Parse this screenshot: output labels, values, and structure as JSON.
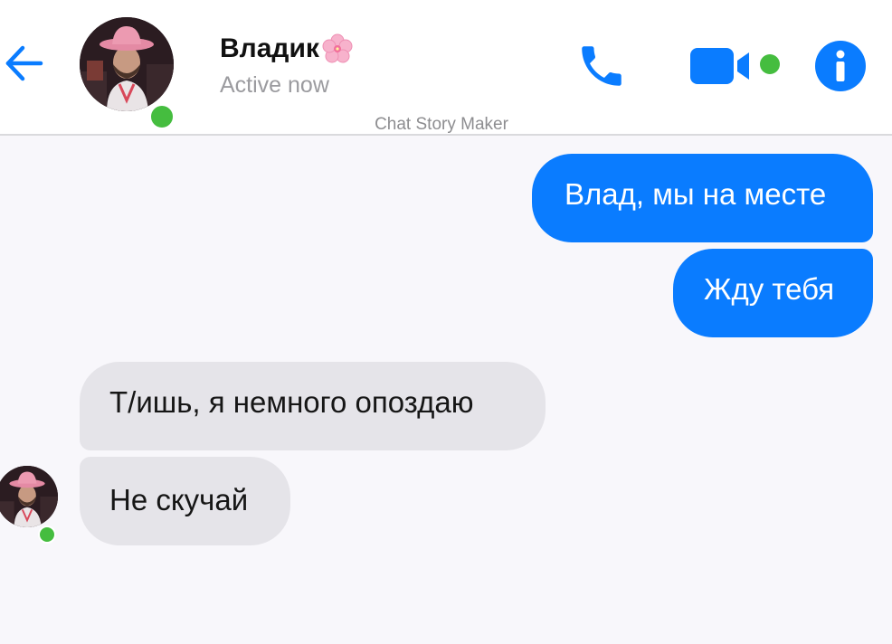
{
  "header": {
    "contact_name": "Владик",
    "status": "Active now",
    "watermark": "Chat Story Maker"
  },
  "icons": {
    "back": "back-arrow-icon",
    "call": "phone-icon",
    "video": "video-camera-icon",
    "info": "info-icon",
    "name_emoji": "cherry-blossom-icon"
  },
  "colors": {
    "accent": "#0a7cff",
    "online": "#45bd3f",
    "received_bubble": "#e5e4e9"
  },
  "messages": [
    {
      "direction": "sent",
      "text": "Влад, мы на месте"
    },
    {
      "direction": "sent",
      "text": "Жду тебя"
    },
    {
      "direction": "received",
      "text": "Т/ишь, я немного опоздаю"
    },
    {
      "direction": "received",
      "text": "Не скучай"
    }
  ]
}
